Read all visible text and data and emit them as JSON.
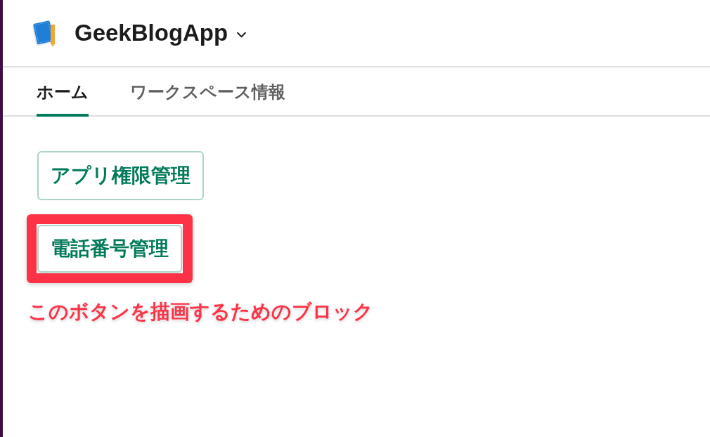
{
  "app": {
    "name": "GeekBlogApp"
  },
  "tabs": [
    {
      "label": "ホーム",
      "selected": true
    },
    {
      "label": "ワークスペース情報",
      "selected": false
    }
  ],
  "buttons": [
    {
      "label": "アプリ権限管理",
      "highlighted": false
    },
    {
      "label": "電話番号管理",
      "highlighted": true
    }
  ],
  "annotation": {
    "text": "このボタンを描画するためのブロック"
  }
}
